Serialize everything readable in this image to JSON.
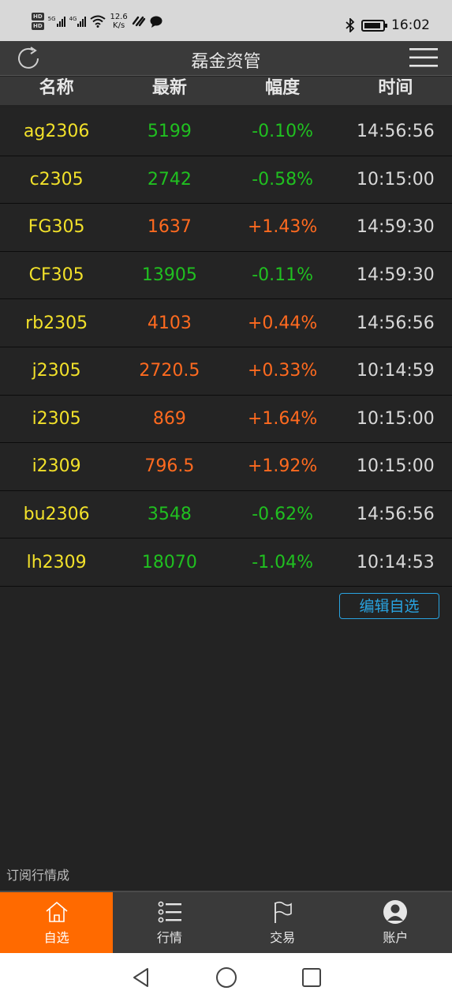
{
  "status_bar": {
    "network_speed": "12.6",
    "network_speed_unit": "K/s",
    "time": "16:02"
  },
  "header": {
    "title": "磊金资管"
  },
  "columns": [
    "名称",
    "最新",
    "幅度",
    "时间"
  ],
  "rows": [
    {
      "name": "ag2306",
      "price": "5199",
      "change": "-0.10%",
      "time": "14:56:56",
      "dir": "down"
    },
    {
      "name": "c2305",
      "price": "2742",
      "change": "-0.58%",
      "time": "10:15:00",
      "dir": "down"
    },
    {
      "name": "FG305",
      "price": "1637",
      "change": "+1.43%",
      "time": "14:59:30",
      "dir": "up"
    },
    {
      "name": "CF305",
      "price": "13905",
      "change": "-0.11%",
      "time": "14:59:30",
      "dir": "down"
    },
    {
      "name": "rb2305",
      "price": "4103",
      "change": "+0.44%",
      "time": "14:56:56",
      "dir": "up"
    },
    {
      "name": "j2305",
      "price": "2720.5",
      "change": "+0.33%",
      "time": "10:14:59",
      "dir": "up"
    },
    {
      "name": "i2305",
      "price": "869",
      "change": "+1.64%",
      "time": "10:15:00",
      "dir": "up"
    },
    {
      "name": "i2309",
      "price": "796.5",
      "change": "+1.92%",
      "time": "10:15:00",
      "dir": "up"
    },
    {
      "name": "bu2306",
      "price": "3548",
      "change": "-0.62%",
      "time": "14:56:56",
      "dir": "down"
    },
    {
      "name": "lh2309",
      "price": "18070",
      "change": "-1.04%",
      "time": "10:14:53",
      "dir": "down"
    }
  ],
  "edit_button": "编辑自选",
  "subscription_status": "订阅行情成",
  "tabs": [
    {
      "label": "自选",
      "icon": "home-icon",
      "active": true
    },
    {
      "label": "行情",
      "icon": "list-icon",
      "active": false
    },
    {
      "label": "交易",
      "icon": "flag-icon",
      "active": false
    },
    {
      "label": "账户",
      "icon": "user-icon",
      "active": false
    }
  ],
  "colors": {
    "up": "#ff6a1f",
    "down": "#20c020",
    "name": "#f2e12a",
    "accent": "#ff6a00",
    "edit_button": "#29a3e0"
  }
}
